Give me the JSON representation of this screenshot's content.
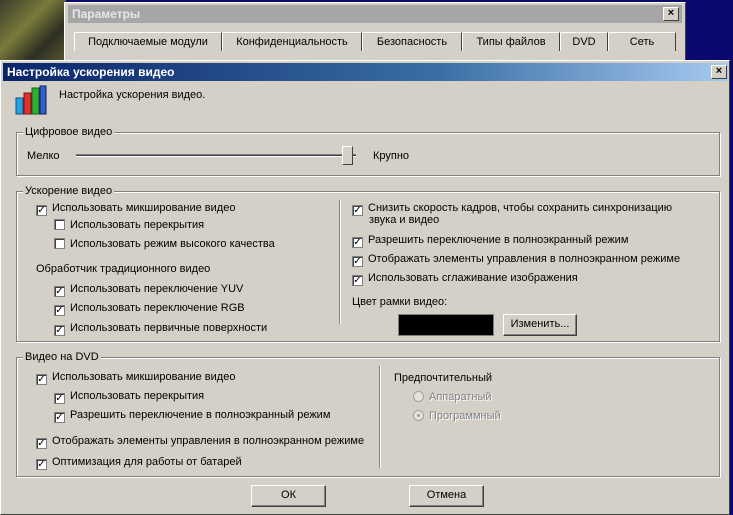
{
  "background_window": {
    "title": "Параметры",
    "tabs": [
      "Подключаемые модули",
      "Конфиденциальность",
      "Безопасность",
      "Типы файлов",
      "DVD",
      "Сеть"
    ]
  },
  "dialog": {
    "title": "Настройка ускорения видео",
    "header_text": "Настройка ускорения видео.",
    "close_glyph": "×"
  },
  "digital_video": {
    "label": "Цифровое видео",
    "min_label": "Мелко",
    "max_label": "Крупно",
    "slider_value": 0.99
  },
  "acceleration": {
    "label": "Ускорение видео",
    "mixing": {
      "label": "Использовать микширование видео",
      "checked": true
    },
    "overlays": {
      "label": "Использовать перекрытия",
      "checked": false
    },
    "high_quality": {
      "label": "Использовать режим высокого качества",
      "checked": false
    },
    "legacy_label": "Обработчик традиционного видео",
    "yuv": {
      "label": "Использовать переключение YUV",
      "checked": true
    },
    "rgb": {
      "label": "Использовать переключение RGB",
      "checked": true
    },
    "primary": {
      "label": "Использовать первичные поверхности",
      "checked": true
    },
    "reduce_fps": {
      "label_line1": "Снизить скорость кадров, чтобы сохранить синхронизацию",
      "label_line2": "звука и видео",
      "checked": true
    },
    "fullscreen_switch": {
      "label": "Разрешить переключение в полноэкранный режим",
      "checked": true
    },
    "show_controls": {
      "label": "Отображать элементы управления в полноэкранном режиме",
      "checked": true
    },
    "smoothing": {
      "label": "Использовать сглаживание изображения",
      "checked": true
    },
    "border_color_label": "Цвет рамки видео:",
    "border_color": "#000000",
    "change_button": "Изменить..."
  },
  "dvd": {
    "label": "Видео на DVD",
    "mixing": {
      "label": "Использовать микширование видео",
      "checked": true
    },
    "overlays": {
      "label": "Использовать перекрытия",
      "checked": true
    },
    "fullscreen_switch": {
      "label": "Разрешить переключение в полноэкранный режим",
      "checked": true
    },
    "show_controls": {
      "label": "Отображать элементы управления в полноэкранном режиме",
      "checked": true
    },
    "battery": {
      "label": "Оптимизация для работы от батарей",
      "checked": true
    },
    "preferred_label": "Предпочтительный",
    "hardware": "Аппаратный",
    "software": "Программный",
    "selected": "software"
  },
  "buttons": {
    "ok": "ОК",
    "cancel": "Отмена"
  },
  "check_glyph": "✓"
}
